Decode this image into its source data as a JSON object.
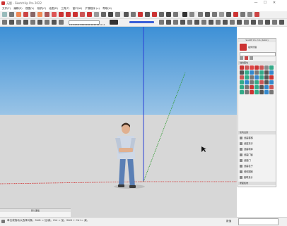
{
  "window": {
    "title": "无题 - SketchUp Pro 2022",
    "minimize": "—",
    "maximize": "☐",
    "close": "✕"
  },
  "menu": [
    "文件(F)",
    "编辑(E)",
    "视图(V)",
    "相机(C)",
    "绘图(R)",
    "工具(T)",
    "窗口(W)",
    "扩展程序 (x)",
    "帮助(H)"
  ],
  "colors": {
    "sky_top": "#3d90d6",
    "sky_bottom": "#9ac4e6",
    "ground": "#d7d7d7",
    "axis_red": "#d23030",
    "axis_green": "#2f9a2f",
    "axis_blue": "#2a3fd6",
    "accent": "#e05a1f"
  },
  "toolbar": {
    "scale_ticks": "1 2 3 4 5 6 7 8 9 10 11 12 13 14 15 16"
  },
  "panel": {
    "header": "SUAPP Pro 3.6 (64bit)",
    "subtitle": "插件管理",
    "sections": [
      "轴线图块",
      "建筑设施"
    ],
    "list_items": [
      "创建楼梯",
      "创建扶手",
      "创建墙体",
      "创建门窗",
      "创建门",
      "创建柱子",
      "墙体图案",
      "建筑设计"
    ],
    "footer": "屋面板坡"
  },
  "tray": {
    "title": "默认面板"
  },
  "status": {
    "text": "单击或拖动以选择对象。Shift = 加/减。Ctrl = 加。Shift + Ctrl = 减。",
    "measure_label": "数值"
  }
}
